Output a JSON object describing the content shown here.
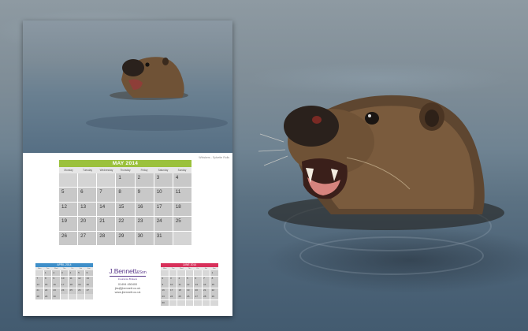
{
  "image_credit": "Whiskers - Sylvette Rolls",
  "main_calendar": {
    "title": "MAY 2014",
    "accent": "#9bc13c",
    "days": [
      "Monday",
      "Tuesday",
      "Wednesday",
      "Thursday",
      "Friday",
      "Saturday",
      "Sunday"
    ],
    "weeks": [
      [
        "",
        "",
        "",
        "1",
        "2",
        "3",
        "4"
      ],
      [
        "5",
        "6",
        "7",
        "8",
        "9",
        "10",
        "11"
      ],
      [
        "12",
        "13",
        "14",
        "15",
        "16",
        "17",
        "18"
      ],
      [
        "19",
        "20",
        "21",
        "22",
        "23",
        "24",
        "25"
      ],
      [
        "26",
        "27",
        "28",
        "29",
        "30",
        "31",
        ""
      ]
    ]
  },
  "prev_calendar": {
    "title": "APRIL 2014",
    "accent": "#3f8fc9",
    "days": [
      "Mon",
      "Tue",
      "Wed",
      "Thu",
      "Fri",
      "Sat",
      "Sun"
    ],
    "weeks": [
      [
        "",
        "1",
        "2",
        "3",
        "4",
        "5",
        "6"
      ],
      [
        "7",
        "8",
        "9",
        "10",
        "11",
        "12",
        "13"
      ],
      [
        "14",
        "15",
        "16",
        "17",
        "18",
        "19",
        "20"
      ],
      [
        "21",
        "22",
        "23",
        "24",
        "25",
        "26",
        "27"
      ],
      [
        "28",
        "29",
        "30",
        "",
        "",
        "",
        ""
      ]
    ]
  },
  "next_calendar": {
    "title": "JUNE 2014",
    "accent": "#d8315b",
    "days": [
      "Mon",
      "Tue",
      "Wed",
      "Thu",
      "Fri",
      "Sat",
      "Sun"
    ],
    "weeks": [
      [
        "",
        "",
        "",
        "",
        "",
        "",
        "1"
      ],
      [
        "2",
        "3",
        "4",
        "5",
        "6",
        "7",
        "8"
      ],
      [
        "9",
        "10",
        "11",
        "12",
        "13",
        "14",
        "15"
      ],
      [
        "16",
        "17",
        "18",
        "19",
        "20",
        "21",
        "22"
      ],
      [
        "23",
        "24",
        "25",
        "26",
        "27",
        "28",
        "29"
      ],
      [
        "30",
        "",
        "",
        "",
        "",
        "",
        ""
      ]
    ]
  },
  "logo": {
    "name": "J.Bennett",
    "amp": "&Son",
    "subtitle": "Insurance Brokers",
    "color": "#5b3a8c"
  },
  "contact": {
    "phone": "01494 450400",
    "email": "jbs@jbennett.co.uk",
    "website": "www.jbennett.co.uk"
  }
}
